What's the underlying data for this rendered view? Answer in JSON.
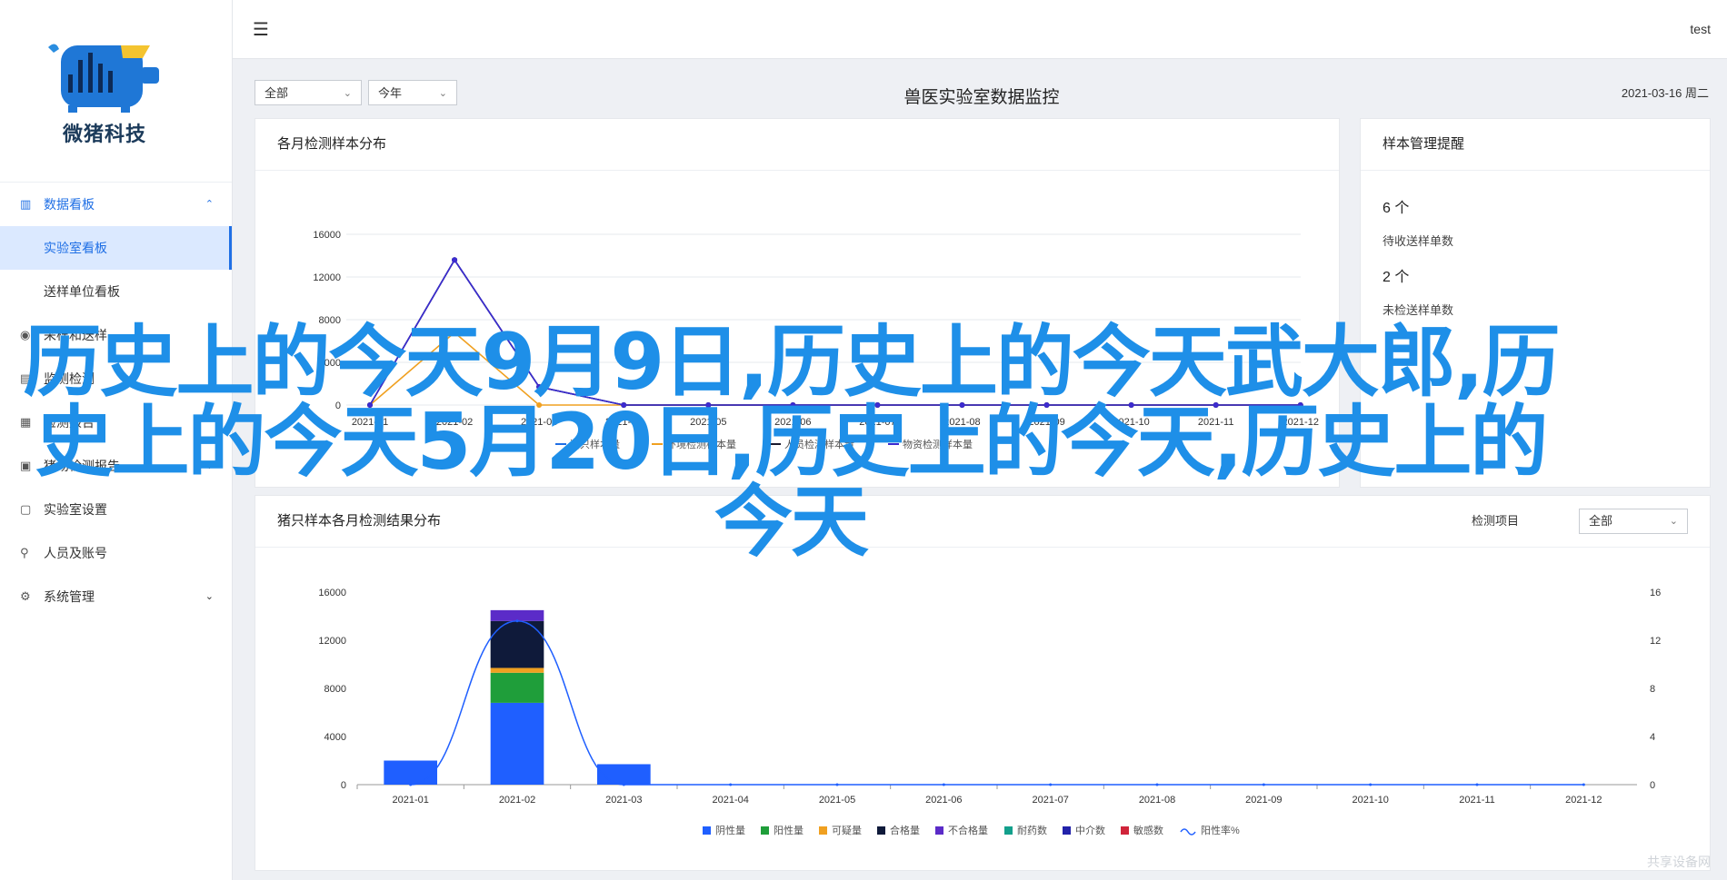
{
  "app": {
    "brand": "微猪科技",
    "user": "test"
  },
  "menu": [
    {
      "label": "数据看板",
      "icon": "bar-chart-icon",
      "state": "open"
    },
    {
      "label": "实验室看板",
      "sub": true,
      "state": "active"
    },
    {
      "label": "送样单位看板",
      "sub": true
    },
    {
      "label": "采样和送样",
      "icon": "sample-icon"
    },
    {
      "label": "监测检测",
      "icon": "monitor-icon"
    },
    {
      "label": "检测报告",
      "icon": "report-icon"
    },
    {
      "label": "猪场检测报告",
      "icon": "doc-icon",
      "caret": true
    },
    {
      "label": "实验室设置",
      "icon": "lab-icon"
    },
    {
      "label": "人员及账号",
      "icon": "user-icon"
    },
    {
      "label": "系统管理",
      "icon": "gear-icon",
      "caret": true
    }
  ],
  "filters": {
    "scope": "全部",
    "period": "今年"
  },
  "page": {
    "title": "兽医实验室数据监控",
    "date": "2021-03-16 周二"
  },
  "panel1": {
    "title": "各月检测样本分布"
  },
  "panel2": {
    "title": "样本管理提醒",
    "items": [
      {
        "count": "6 个",
        "label": "待收送样单数"
      },
      {
        "count": "2 个",
        "label": "未检送样单数"
      }
    ]
  },
  "panel3": {
    "title": "猪只样本各月检测结果分布",
    "filter_label": "检测项目",
    "filter_value": "全部"
  },
  "overlay_text": "历史上的今天9月9日,历史上的今天武大郎,历史上的今天5月20日,历史上的今天,历史上的今天",
  "watermark": "共享设备网",
  "colors": {
    "accent": "#1f6fe5",
    "overlay": "#1e8fe8"
  },
  "chart_data": [
    {
      "type": "line",
      "title": "",
      "categories": [
        "2021-01",
        "2021-02",
        "2021-03",
        "2021-04",
        "2021-05",
        "2021-06",
        "2021-07",
        "2021-08",
        "2021-09",
        "2021-10",
        "2021-11",
        "2021-12"
      ],
      "ylim": [
        0,
        16000
      ],
      "yticks": [
        0,
        4000,
        8000,
        12000,
        16000
      ],
      "series": [
        {
          "name": "猪只样本量",
          "color": "#1f6fe5",
          "values": [
            0,
            13600,
            1700,
            0,
            0,
            0,
            0,
            0,
            0,
            0,
            0,
            0
          ]
        },
        {
          "name": "环境检测样本量",
          "color": "#f0a020",
          "values": [
            0,
            6800,
            0,
            0,
            0,
            0,
            0,
            0,
            0,
            0,
            0,
            0
          ]
        },
        {
          "name": "人员检测样本量",
          "color": "#1a1a2e",
          "values": [
            0,
            13600,
            1700,
            0,
            0,
            0,
            0,
            0,
            0,
            0,
            0,
            0
          ]
        },
        {
          "name": "物资检测样本量",
          "color": "#3d2bd0",
          "values": [
            0,
            13600,
            1700,
            0,
            0,
            0,
            0,
            0,
            0,
            0,
            0,
            0
          ]
        }
      ],
      "grid": true,
      "legend": "bottom"
    },
    {
      "type": "bar",
      "title": "",
      "categories": [
        "2021-01",
        "2021-02",
        "2021-03",
        "2021-04",
        "2021-05",
        "2021-06",
        "2021-07",
        "2021-08",
        "2021-09",
        "2021-10",
        "2021-11",
        "2021-12"
      ],
      "ylim": [
        0,
        16000
      ],
      "yticks": [
        0,
        4000,
        8000,
        12000,
        16000
      ],
      "y2lim": [
        0,
        16
      ],
      "y2ticks": [
        0,
        4,
        8,
        12,
        16
      ],
      "stacked": true,
      "series": [
        {
          "name": "阴性量",
          "color": "#1f5fff",
          "values": [
            2000,
            6800,
            1700,
            0,
            0,
            0,
            0,
            0,
            0,
            0,
            0,
            0
          ]
        },
        {
          "name": "阳性量",
          "color": "#1f9e3a",
          "values": [
            0,
            2500,
            0,
            0,
            0,
            0,
            0,
            0,
            0,
            0,
            0,
            0
          ]
        },
        {
          "name": "可疑量",
          "color": "#f0a020",
          "values": [
            0,
            400,
            0,
            0,
            0,
            0,
            0,
            0,
            0,
            0,
            0,
            0
          ]
        },
        {
          "name": "合格量",
          "color": "#0f1a3a",
          "values": [
            0,
            3900,
            0,
            0,
            0,
            0,
            0,
            0,
            0,
            0,
            0,
            0
          ]
        },
        {
          "name": "不合格量",
          "color": "#5b2bc8",
          "values": [
            0,
            900,
            0,
            0,
            0,
            0,
            0,
            0,
            0,
            0,
            0,
            0
          ]
        },
        {
          "name": "耐药数",
          "color": "#12a08c",
          "values": [
            0,
            0,
            0,
            0,
            0,
            0,
            0,
            0,
            0,
            0,
            0,
            0
          ]
        },
        {
          "name": "中介数",
          "color": "#2222aa",
          "values": [
            0,
            0,
            0,
            0,
            0,
            0,
            0,
            0,
            0,
            0,
            0,
            0
          ]
        },
        {
          "name": "敏感数",
          "color": "#d0243a",
          "values": [
            0,
            0,
            0,
            0,
            0,
            0,
            0,
            0,
            0,
            0,
            0,
            0
          ]
        }
      ],
      "line_series": {
        "name": "阳性率%",
        "color": "#1f5fff",
        "values": [
          0,
          13.6,
          0,
          0,
          0,
          0,
          0,
          0,
          0,
          0,
          0,
          0
        ]
      },
      "grid": false,
      "legend": "bottom"
    }
  ]
}
